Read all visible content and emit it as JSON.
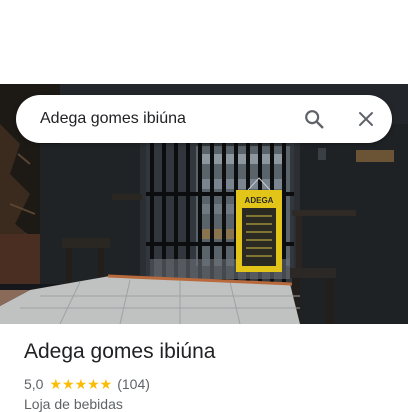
{
  "search": {
    "query": "Adega gomes ibiúna",
    "search_icon": "search-icon",
    "close_icon": "close-icon"
  },
  "photo": {
    "sign_label": "ADEGA"
  },
  "place": {
    "name": "Adega gomes ibiúna",
    "rating": "5,0",
    "stars": "★★★★★",
    "review_count": "(104)",
    "category": "Loja de bebidas"
  },
  "colors": {
    "star": "#fbbc04",
    "text_primary": "#202124",
    "text_secondary": "#5f6368"
  }
}
